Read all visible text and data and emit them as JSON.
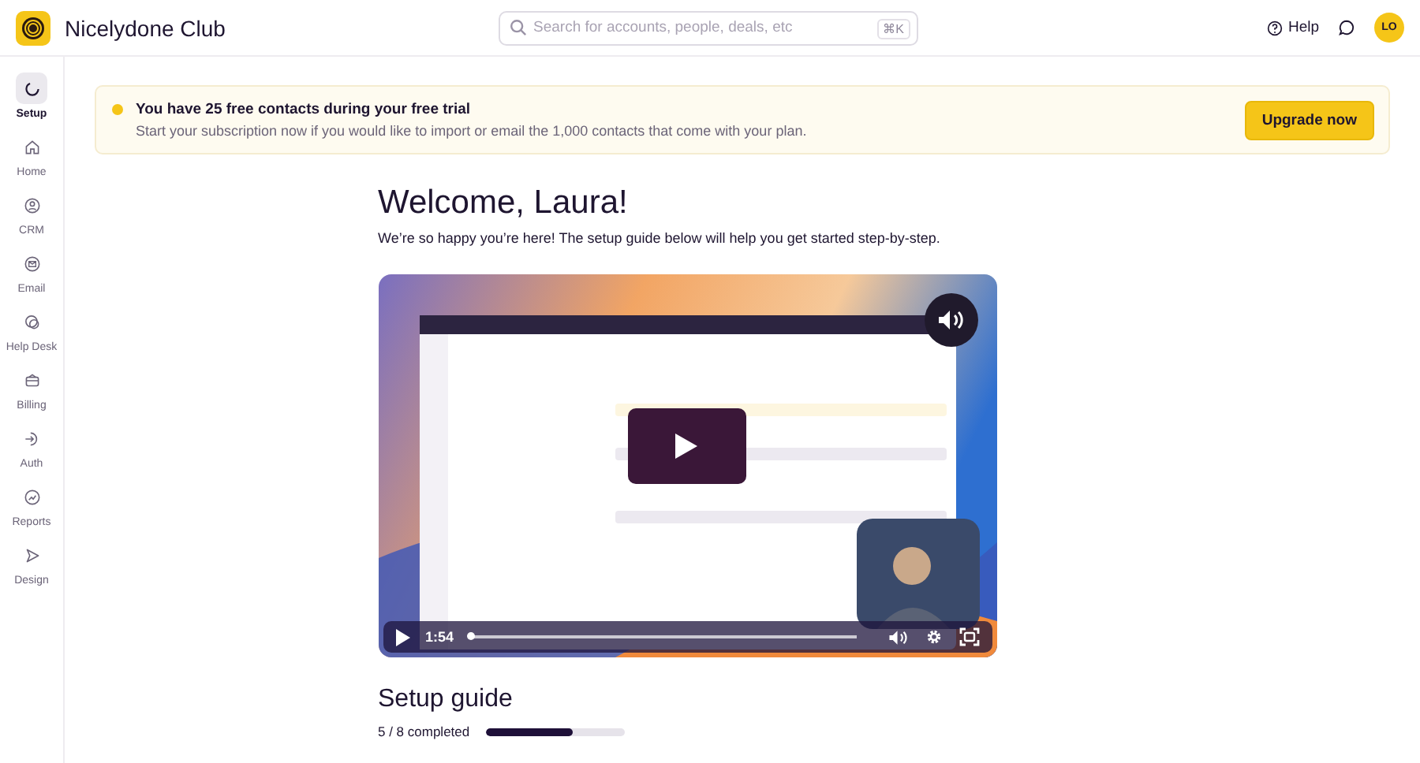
{
  "app": {
    "name": "Nicelydone Club"
  },
  "search": {
    "placeholder": "Search for accounts, people, deals, etc",
    "shortcut": "⌘K"
  },
  "header": {
    "help": "Help",
    "avatar": "LO"
  },
  "sidebar": {
    "items": [
      {
        "label": "Setup",
        "selected": true
      },
      {
        "label": "Home",
        "selected": false
      },
      {
        "label": "CRM",
        "selected": false
      },
      {
        "label": "Email",
        "selected": false
      },
      {
        "label": "Help Desk",
        "selected": false
      },
      {
        "label": "Billing",
        "selected": false
      },
      {
        "label": "Auth",
        "selected": false
      },
      {
        "label": "Reports",
        "selected": false
      },
      {
        "label": "Design",
        "selected": false
      }
    ]
  },
  "banner": {
    "title": "You have 25 free contacts during your free trial",
    "text": "Start your subscription now if you would like to import or email the 1,000 contacts that come with your plan.",
    "button": "Upgrade now"
  },
  "welcome": {
    "title": "Welcome, Laura!",
    "subtitle": "We’re so happy you’re here! The setup guide below will help you get started step-by-step."
  },
  "video": {
    "kind": "picture",
    "time": "1:54"
  },
  "guide": {
    "title": "Setup guide",
    "progress_text": "5 / 8 completed",
    "level": 0.625
  }
}
